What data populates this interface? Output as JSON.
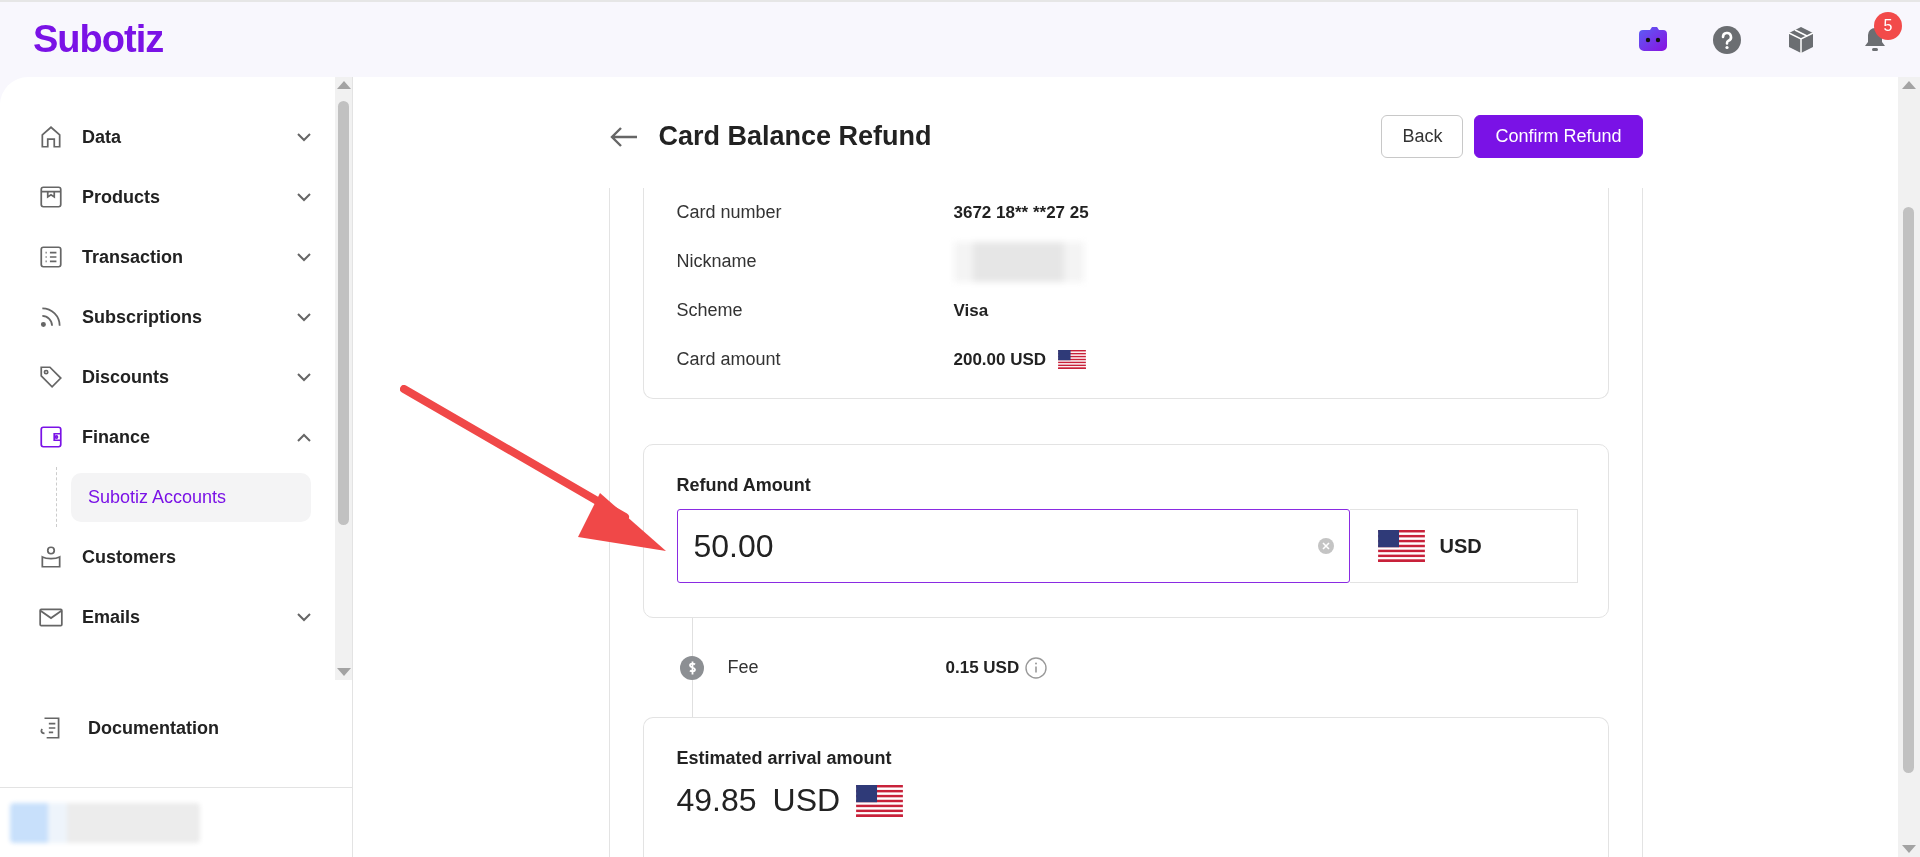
{
  "brand": "Subotiz",
  "header": {
    "notification_count": "5"
  },
  "sidebar": {
    "items": [
      {
        "label": "Data",
        "expanded": false,
        "active": false
      },
      {
        "label": "Products",
        "expanded": false,
        "active": false
      },
      {
        "label": "Transaction",
        "expanded": false,
        "active": false
      },
      {
        "label": "Subscriptions",
        "expanded": false,
        "active": false
      },
      {
        "label": "Discounts",
        "expanded": false,
        "active": false
      },
      {
        "label": "Finance",
        "expanded": true,
        "active": true,
        "children": [
          {
            "label": "Subotiz Accounts",
            "selected": true
          }
        ]
      },
      {
        "label": "Customers",
        "active": false
      },
      {
        "label": "Emails",
        "expanded": false,
        "active": false
      }
    ],
    "footer_item": "Documentation"
  },
  "page": {
    "title": "Card Balance Refund",
    "back_button": "Back",
    "confirm_button": "Confirm Refund"
  },
  "card_details": [
    {
      "label": "Card number",
      "kind": "text",
      "value": "3672 18** **27 25"
    },
    {
      "label": "Nickname",
      "kind": "blurred"
    },
    {
      "label": "Scheme",
      "kind": "text",
      "value": "Visa"
    },
    {
      "label": "Card amount",
      "kind": "flag",
      "value": "200.00 USD"
    }
  ],
  "refund": {
    "label": "Refund Amount",
    "value": "50.00",
    "currency": "USD",
    "focused": true
  },
  "fee": {
    "label": "Fee",
    "value": "0.15 USD"
  },
  "estimate": {
    "label": "Estimated arrival amount",
    "amount": "49.85",
    "currency": "USD"
  }
}
